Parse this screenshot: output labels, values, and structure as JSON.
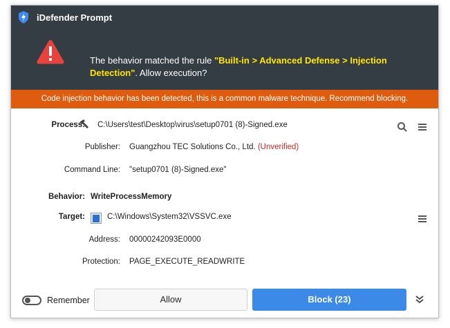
{
  "window": {
    "title": "iDefender Prompt"
  },
  "header": {
    "message_prefix": "The behavior matched the rule ",
    "rule": "\"Built-in > Advanced Defense > Injection Detection\"",
    "message_suffix": ". Allow execution?"
  },
  "alert": {
    "text": "Code injection behavior has been detected, this is a common malware technique. Recommend blocking."
  },
  "details": {
    "process_label": "Process:",
    "process_value": "C:\\Users\\test\\Desktop\\virus\\setup0701 (8)-Signed.exe",
    "publisher_label": "Publisher:",
    "publisher_value": "Guangzhou TEC Solutions Co., Ltd.",
    "publisher_status": "(Unverified)",
    "cmdline_label": "Command Line:",
    "cmdline_value": "\"setup0701 (8)-Signed.exe\"",
    "behavior_label": "Behavior:",
    "behavior_value": "WriteProcessMemory",
    "target_label": "Target:",
    "target_value": "C:\\Windows\\System32\\VSSVC.exe",
    "address_label": "Address:",
    "address_value": "00000242093E0000",
    "protection_label": "Protection:",
    "protection_value": "PAGE_EXECUTE_READWRITE"
  },
  "footer": {
    "remember_label": "Remember",
    "remember_checked": false,
    "allow_label": "Allow",
    "block_label": "Block (23)"
  },
  "colors": {
    "titlebar": "#343c44",
    "rule_highlight": "#ffe600",
    "alert_bar": "#df5b0e",
    "block_button": "#3c8ae8",
    "unverified": "#c62828"
  },
  "icons": {
    "app": "shield-lightning-icon",
    "warning": "warning-triangle-icon",
    "process": "hammer-icon",
    "target": "exe-file-icon",
    "search": "search-icon",
    "menu": "hamburger-menu-icon",
    "expand": "double-chevron-down-icon"
  }
}
